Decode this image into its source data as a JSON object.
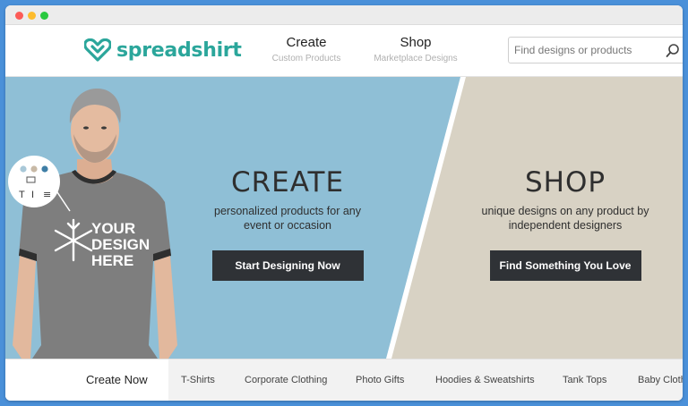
{
  "brand": {
    "name": "spreadshirt",
    "color": "#2ba69b"
  },
  "nav": {
    "create": {
      "label": "Create",
      "sub": "Custom Products"
    },
    "shop": {
      "label": "Shop",
      "sub": "Marketplace Designs"
    }
  },
  "search": {
    "placeholder": "Find designs or products",
    "icon": "search-icon"
  },
  "hero": {
    "create": {
      "title": "CREATE",
      "line1": "personalized products for any",
      "line2": "event or occasion",
      "button": "Start Designing Now",
      "bg_color": "#8fbfd6"
    },
    "shop": {
      "title": "SHOP",
      "line1": "unique designs on any product by",
      "line2": "independent designers",
      "button": "Find Something You Love",
      "bg_color": "#d8d2c4"
    },
    "shirt_graphic": {
      "line1": "YOUR",
      "line2": "DESIGN",
      "line3": "HERE"
    },
    "editor_badge": {
      "swatches": [
        "#a9c8d8",
        "#c8b9a6",
        "#3f7ea6"
      ],
      "tools": [
        "T",
        "I",
        "≡"
      ]
    }
  },
  "categories": {
    "create_now": "Create Now",
    "items": [
      "T-Shirts",
      "Corporate Clothing",
      "Photo Gifts",
      "Hoodies & Sweatshirts",
      "Tank Tops",
      "Baby Cloth"
    ]
  }
}
